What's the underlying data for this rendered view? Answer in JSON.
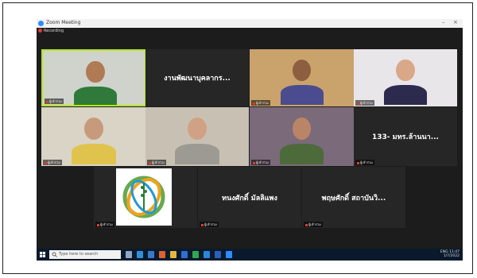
{
  "window": {
    "title": "Zoom Meeting",
    "recording_label": "Recording"
  },
  "tiles": [
    {
      "id": "t1",
      "label": "ผู้เข้าร่วม",
      "active": true,
      "type": "video",
      "bg": "#cfd3cc",
      "head": "#b07a55",
      "shirt": "#2f7a3a"
    },
    {
      "id": "t2",
      "label": "",
      "display_name": "งานพัฒนาบุคลากร...",
      "type": "name"
    },
    {
      "id": "t3",
      "label": "ผู้เข้าร่วม",
      "type": "video",
      "bg": "#c9a36b",
      "head": "#8d5e40",
      "shirt": "#4b4b8f"
    },
    {
      "id": "t4",
      "label": "ผู้เข้าร่วม",
      "type": "video",
      "bg": "#e9e6ea",
      "head": "#d8a888",
      "shirt": "#2c2a4d"
    },
    {
      "id": "t5",
      "label": "ผู้เข้าร่วม",
      "type": "video",
      "bg": "#d9d4c6",
      "head": "#c79a7b",
      "shirt": "#e0c34c"
    },
    {
      "id": "t6",
      "label": "ผู้เข้าร่วม",
      "type": "video",
      "bg": "#c8c1b3",
      "head": "#d0a184",
      "shirt": "#9c9a93"
    },
    {
      "id": "t7",
      "label": "ผู้เข้าร่วม",
      "type": "video",
      "bg": "#7b6a7a",
      "head": "#b98566",
      "shirt": "#4d6a3b"
    },
    {
      "id": "t8",
      "label": "ผู้เข้าร่วม",
      "display_name": "133- มทร.ล้านนา...",
      "type": "name"
    },
    {
      "id": "t9",
      "label": "ผู้เข้าร่วม",
      "type": "logo"
    },
    {
      "id": "t10",
      "label": "ผู้เข้าร่วม",
      "display_name": "ทนงศักดิ์ มัลลิแพง",
      "type": "name"
    },
    {
      "id": "t11",
      "label": "ผู้เข้าร่วม",
      "display_name": "พฤษศักดิ์ สถาบันวิ...",
      "type": "name"
    }
  ],
  "taskbar": {
    "search_placeholder": "Type here to search",
    "time": "11:47",
    "date": "1/7/2022",
    "lang": "ENG",
    "apps": [
      {
        "name": "task-view",
        "color": "#8fa6c8"
      },
      {
        "name": "edge",
        "color": "#2e8fd6"
      },
      {
        "name": "store",
        "color": "#3b78c8"
      },
      {
        "name": "firefox",
        "color": "#e0612b"
      },
      {
        "name": "explorer",
        "color": "#e8b73a"
      },
      {
        "name": "mail",
        "color": "#2f6fd1"
      },
      {
        "name": "chrome",
        "color": "#2fa84f"
      },
      {
        "name": "photos",
        "color": "#2a86d9"
      },
      {
        "name": "word",
        "color": "#2b5fb8"
      },
      {
        "name": "zoom",
        "color": "#2d8cff"
      }
    ]
  }
}
